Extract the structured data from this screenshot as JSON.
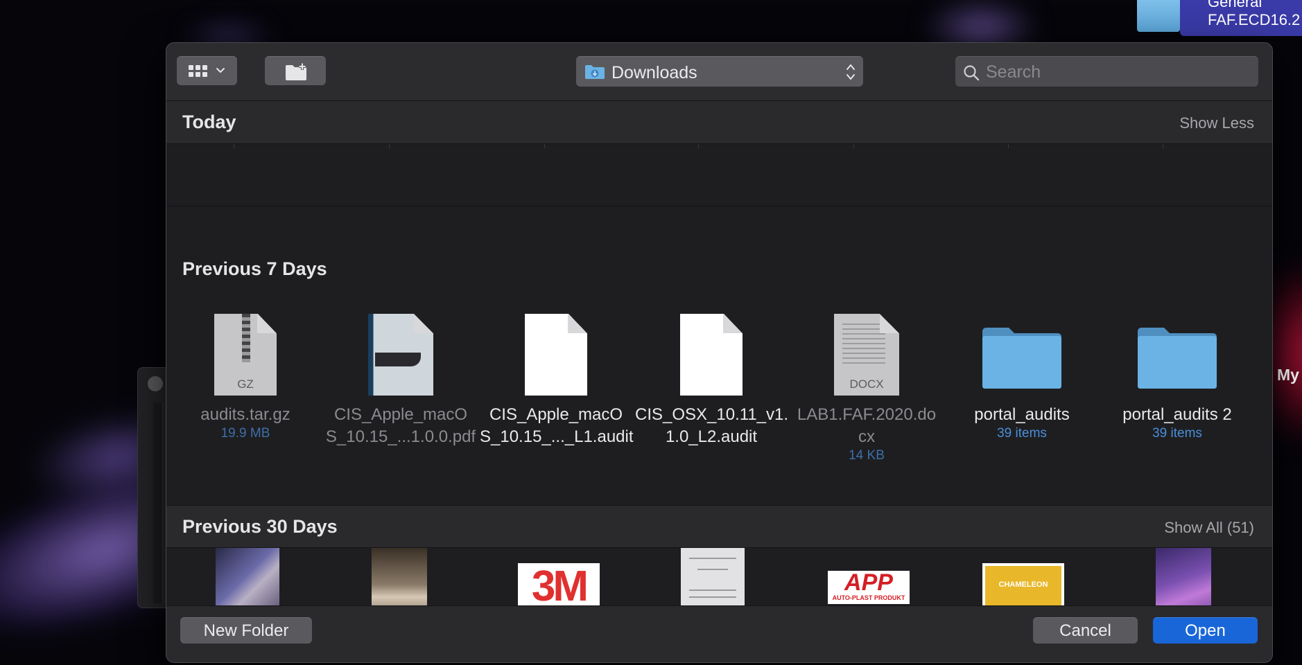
{
  "desktop": {
    "selected_label_line1": "General",
    "selected_label_line2": "FAF.ECD16.2",
    "right_label": "My"
  },
  "dialog": {
    "location": "Downloads",
    "search_placeholder": "Search",
    "sections": {
      "today": {
        "title": "Today",
        "action": "Show Less"
      },
      "previous7": {
        "title": "Previous 7 Days"
      },
      "previous30": {
        "title": "Previous 30 Days",
        "action": "Show All (51)"
      }
    },
    "items7": [
      {
        "name": "audits.tar.gz",
        "meta": "19.9 MB",
        "kind": "gz",
        "badge": "GZ",
        "dim": true
      },
      {
        "name": "CIS_Apple_macOS_10.15_...1.0.0.pdf",
        "kind": "pdf",
        "dim": true
      },
      {
        "name": "CIS_Apple_macOS_10.15_..._L1.audit",
        "kind": "blank"
      },
      {
        "name": "CIS_OSX_10.11_v1.1.0_L2.audit",
        "kind": "blank"
      },
      {
        "name": "LAB1.FAF.2020.docx",
        "meta": "14 KB",
        "kind": "docx",
        "badge": "DOCX",
        "dim": true
      },
      {
        "name": "portal_audits",
        "meta": "39 items",
        "kind": "folder"
      },
      {
        "name": "portal_audits 2",
        "meta": "39 items",
        "kind": "folder"
      }
    ],
    "names_wrapped": {
      "pdf_l1": "CIS_Apple_macO",
      "pdf_l2": "S_10.15_...1.0.0.pdf",
      "audit1_l1": "CIS_Apple_macO",
      "audit1_l2": "S_10.15_..._L1.audit",
      "audit2_l1": "CIS_OSX_10.11_v1.",
      "audit2_l2": "1.0_L2.audit",
      "docx_l1": "LAB1.FAF.2020.do",
      "docx_l2": "cx"
    },
    "thumbs30": {
      "logo_3m": "3M",
      "logo_app": "APP",
      "logo_app_sub": "AUTO-PLAST PRODUKT",
      "logo_cham": "CHAMELEON"
    },
    "footer": {
      "new_folder": "New Folder",
      "cancel": "Cancel",
      "open": "Open"
    }
  },
  "colors": {
    "accent": "#1966d8",
    "folder": "#6bb3e4",
    "meta_link": "#4a8fd8"
  }
}
